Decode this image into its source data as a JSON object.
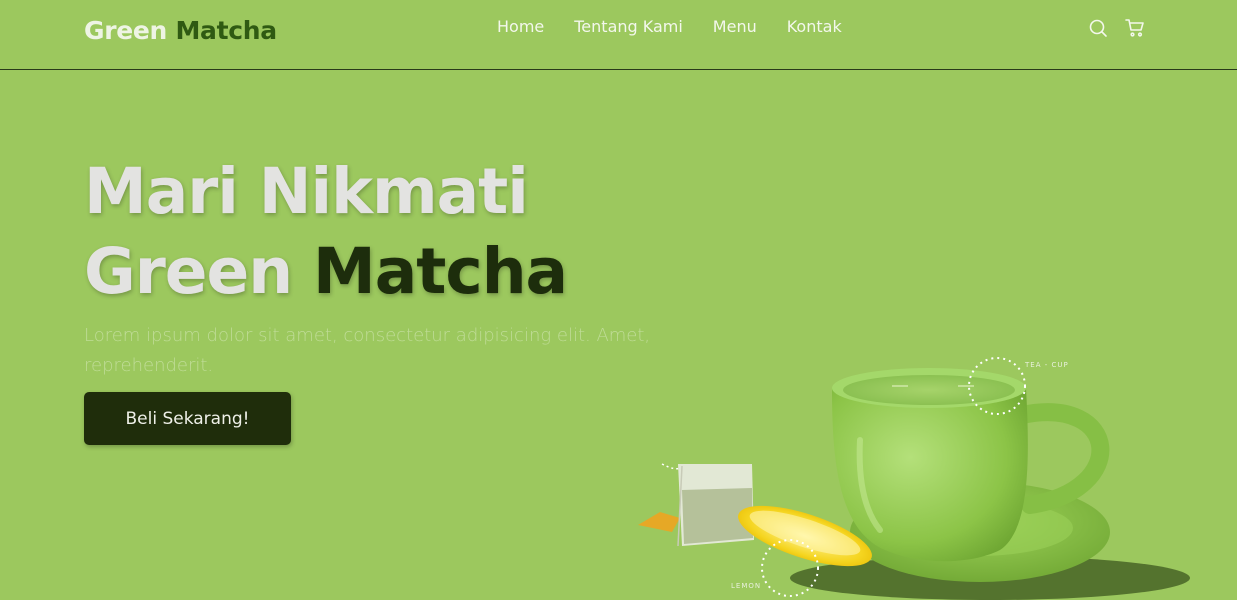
{
  "brand": {
    "part1": "Green",
    "part2": "Matcha"
  },
  "nav": {
    "links": [
      "Home",
      "Tentang Kami",
      "Menu",
      "Kontak"
    ],
    "icons": [
      "search-icon",
      "cart-icon"
    ]
  },
  "hero": {
    "title_line1": "Mari Nikmati",
    "title_line2_a": "Green",
    "title_line2_b": "Matcha",
    "description": "Lorem ipsum dolor sit amet, consectetur adipisicing elit. Amet, reprehenderit.",
    "cta_label": "Beli Sekarang!"
  },
  "illustration": {
    "cup_label": "TEA - CUP",
    "lemon_label": "LEMON"
  },
  "colors": {
    "background": "#9cc85e",
    "dark_green": "#1f2d0b",
    "brand_dark": "#2f5a12"
  }
}
